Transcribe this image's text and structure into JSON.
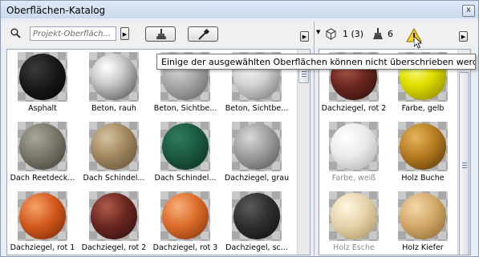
{
  "window": {
    "title": "Oberflächen-Katalog",
    "close_label": "x"
  },
  "toolbar": {
    "search_placeholder": "Projekt-Oberfläch...",
    "selected_count": "1 (3)",
    "brush_count": "6"
  },
  "tooltip": "Einige der ausgewählten Oberflächen können nicht überschrieben werden.",
  "left_pane": {
    "tiles": [
      {
        "label": "Asphalt",
        "sphere": "radial-gradient(circle at 35% 32%, #3a3a3a, #141414 55%, #050505)"
      },
      {
        "label": "Beton, rauh",
        "sphere": "radial-gradient(circle at 35% 30%, #ffffff, #cfcfcf 35%, #7a7a7a 75%, #3e3e3e)"
      },
      {
        "label": "Beton, Sichtbe...",
        "sphere": "radial-gradient(circle at 35% 30%, #d8d8d8, #a4a4a4 45%, #5d5d5d)"
      },
      {
        "label": "Beton, Sichtbe...",
        "sphere": "radial-gradient(circle at 35% 30%, #f5f5f5, #d3d3d3 40%, #8e8e8e 80%, #5a5a5a)"
      },
      {
        "label": "Dach Reetdeck...",
        "sphere": "radial-gradient(circle at 35% 30%, #aaa697, #7a7669 45%, #3c3a33)"
      },
      {
        "label": "Dach Schindel...",
        "sphere": "radial-gradient(circle at 35% 30%, #d6c4a0, #a08660 45%, #5b4a32)"
      },
      {
        "label": "Dach Schindel...",
        "sphere": "radial-gradient(circle at 35% 30%, #2f7a5c, #1b5a40 45%, #0b2a1d)"
      },
      {
        "label": "Dachziegel, grau",
        "sphere": "radial-gradient(circle at 35% 30%, #d8d8d8, #9c9c9c 45%, #4e4e4e)"
      },
      {
        "label": "Dachziegel, rot 1",
        "sphere": "radial-gradient(circle at 35% 30%, #f6a46a, #d2581d 45%, #6e2508)"
      },
      {
        "label": "Dachziegel, rot 2",
        "sphere": "radial-gradient(circle at 35% 30%, #b05a4a, #6a2620 45%, #2a0d0a)"
      },
      {
        "label": "Dachziegel, rot 3",
        "sphere": "radial-gradient(circle at 35% 30%, #f7b07a, #dc6a2a 45%, #7a300a)"
      },
      {
        "label": "Dachziegel, sc...",
        "sphere": "radial-gradient(circle at 35% 30%, #5a5a5a, #2e2e2e 45%, #0e0e0e)"
      }
    ]
  },
  "right_pane": {
    "tiles": [
      {
        "label": "Dachziegel, rot 2",
        "grey": false,
        "sphere": "radial-gradient(circle at 35% 30%, #b05a4a, #6a2620 45%, #2a0d0a)"
      },
      {
        "label": "Farbe, gelb",
        "grey": false,
        "sphere": "radial-gradient(circle at 35% 30%, #fbff8a, #e1e000 40%, #7e7a00)"
      },
      {
        "label": "Farbe, weiß",
        "grey": true,
        "sphere": "radial-gradient(circle at 35% 30%, #ffffff, #eaeaea 45%, #a8a8a8)"
      },
      {
        "label": "Holz Buche",
        "grey": false,
        "sphere": "radial-gradient(circle at 35% 30%, #e7b45a, #b57b22 45%, #4e300a)"
      },
      {
        "label": "Holz Esche",
        "grey": true,
        "sphere": "radial-gradient(circle at 35% 30%, #fff7e3, #e6d2a9 45%, #a08a5a)"
      },
      {
        "label": "Holz Kiefer",
        "grey": false,
        "sphere": "radial-gradient(circle at 35% 30%, #f4d8a8, #d2a868 45%, #82602a)"
      }
    ]
  }
}
